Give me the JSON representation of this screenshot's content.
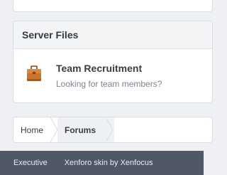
{
  "section": {
    "title": "Server Files",
    "node": {
      "icon": "briefcase-icon",
      "title": "Team Recruitment",
      "description": "Looking for team members?"
    }
  },
  "breadcrumb": {
    "items": [
      "Home",
      "Forums"
    ]
  },
  "footer": {
    "style_name": "Executive",
    "credit": "Xenforo skin by Xenfocus"
  },
  "colors": {
    "footer_bg": "#505767",
    "icon": "#c8742c"
  }
}
